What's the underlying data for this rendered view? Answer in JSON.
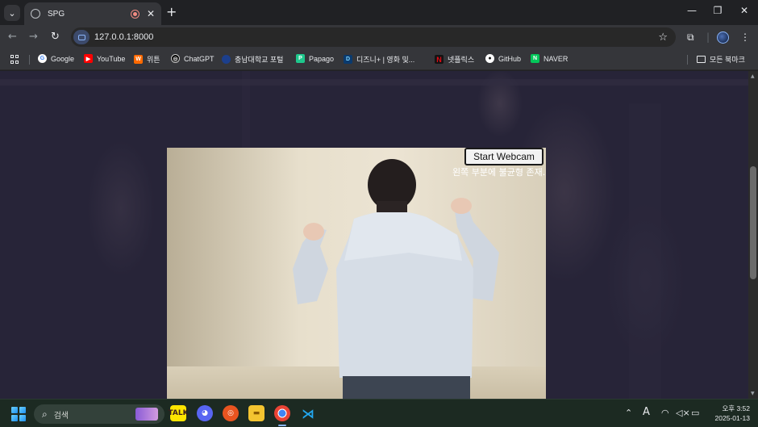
{
  "tab": {
    "title": "SPG",
    "close_glyph": "✕"
  },
  "new_tab_glyph": "+",
  "toolbar": {
    "url": "127.0.0.1:8000"
  },
  "bookmarks": [
    {
      "label": "Google",
      "color": "#ffffff",
      "mark": "G",
      "mark_color": "#4285f4"
    },
    {
      "label": "YouTube",
      "color": "#ff0000",
      "mark": "▶",
      "mark_color": "#ffffff"
    },
    {
      "label": "위튼",
      "color": "#ff6a00",
      "mark": "W",
      "mark_color": "#ffffff"
    },
    {
      "label": "ChatGPT",
      "color": "#000000",
      "mark": "◎",
      "mark_color": "#ffffff"
    },
    {
      "label": "충남대학교 포털",
      "color": "#1c3f8c",
      "mark": "●",
      "mark_color": "#7fa0ff"
    },
    {
      "label": "Papago",
      "color": "#1ec88c",
      "mark": "P",
      "mark_color": "#ffffff"
    },
    {
      "label": "디즈니+ | 영화 및...",
      "color": "#0a3a6e",
      "mark": "D",
      "mark_color": "#7fd6ff"
    },
    {
      "label": "넷플릭스",
      "color": "#141414",
      "mark": "N",
      "mark_color": "#e50914"
    },
    {
      "label": "GitHub",
      "color": "#ffffff",
      "mark": "●",
      "mark_color": "#111111"
    },
    {
      "label": "NAVER",
      "color": "#03c75a",
      "mark": "N",
      "mark_color": "#ffffff"
    }
  ],
  "all_bookmarks_label": "모든 북마크",
  "page": {
    "webcam_button_label": "Start Webcam",
    "status_message": "왼쪽 부분에 불균형 존재."
  },
  "taskbar": {
    "search_placeholder": "검색",
    "clock_time": "오후 3:52",
    "clock_date": "2025-01-13",
    "ime_label": "A"
  },
  "colors": {
    "page_bg": "#272438",
    "chrome_bg": "#35363a",
    "accent": "#8ab4f8"
  }
}
